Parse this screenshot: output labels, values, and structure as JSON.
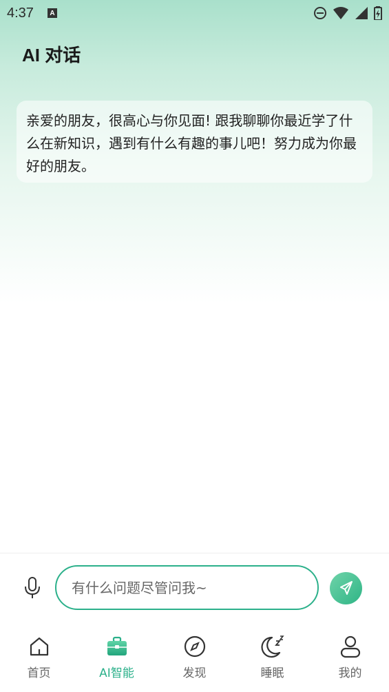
{
  "status_bar": {
    "time": "4:37",
    "notification_icon": "a-icon",
    "icons": [
      "do-not-disturb-icon",
      "wifi-icon",
      "signal-icon",
      "battery-icon"
    ]
  },
  "header": {
    "title": "AI 对话"
  },
  "chat": {
    "messages": [
      {
        "sender": "ai",
        "text": "亲爱的朋友，很高心与你见面! 跟我聊聊你最近学了什么在新知识，遇到有什么有趣的事儿吧！努力成为你最好的朋友。"
      }
    ]
  },
  "input_bar": {
    "placeholder": "有什么问题尽管问我~",
    "value": "",
    "mic_icon": "microphone-icon",
    "send_icon": "send-icon"
  },
  "bottom_nav": {
    "items": [
      {
        "label": "首页",
        "icon": "home-icon",
        "active": false
      },
      {
        "label": "AI智能",
        "icon": "briefcase-icon",
        "active": true
      },
      {
        "label": "发现",
        "icon": "compass-icon",
        "active": false
      },
      {
        "label": "睡眠",
        "icon": "moon-sleep-icon",
        "active": false
      },
      {
        "label": "我的",
        "icon": "profile-icon",
        "active": false
      }
    ]
  },
  "colors": {
    "accent": "#2bb08a",
    "header_gradient_top": "#a9e0cb",
    "inactive_nav": "#666666"
  }
}
